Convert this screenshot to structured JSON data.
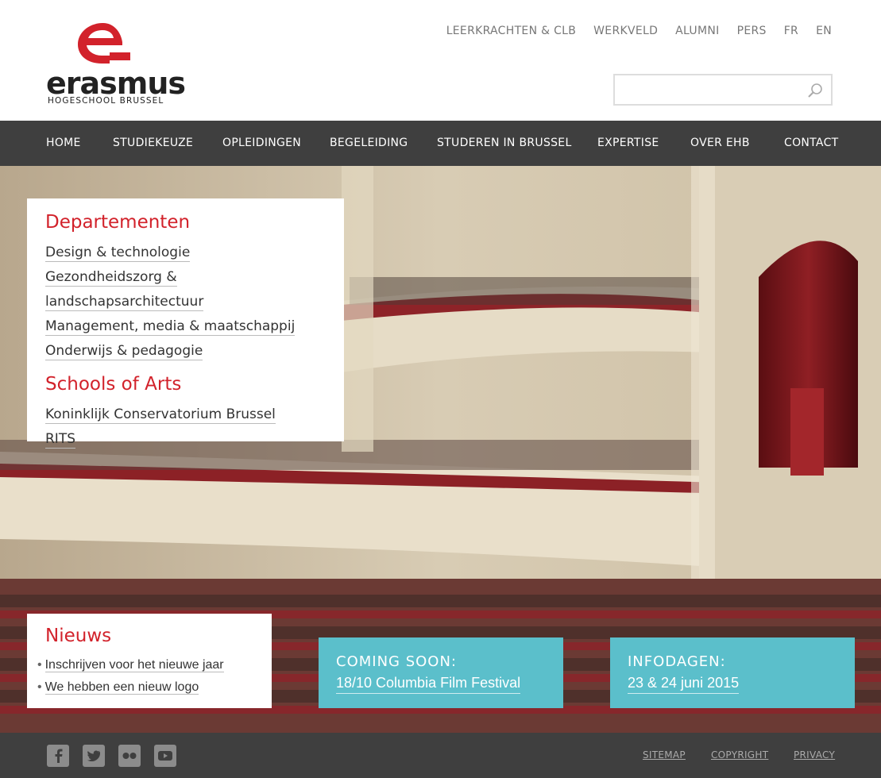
{
  "brand": {
    "name": "erasmus",
    "subtitle": "HOGESCHOOL  BRUSSEL",
    "accent_color": "#d2222b"
  },
  "topnav": {
    "items": [
      "LEERKRACHTEN & CLB",
      "WERKVELD",
      "ALUMNI",
      "PERS",
      "FR",
      "EN"
    ]
  },
  "search": {
    "value": "",
    "placeholder": "",
    "icon": "search-icon"
  },
  "mainnav": {
    "items": [
      "HOME",
      "STUDIEKEUZE",
      "OPLEIDINGEN",
      "BEGELEIDING",
      "STUDEREN IN BRUSSEL",
      "EXPERTISE",
      "OVER EHB",
      "CONTACT"
    ]
  },
  "departments": {
    "heading": "Departementen",
    "items": [
      "Design & technologie",
      "Gezondheidszorg & landschapsarchitectuur",
      "Management, media & maatschappij",
      "Onderwijs & pedagogie"
    ],
    "schools_heading": "Schools of Arts",
    "schools": [
      "Koninklijk Conservatorium Brussel",
      "RITS"
    ]
  },
  "news": {
    "heading": "Nieuws",
    "items": [
      "Inschrijven voor het nieuwe jaar",
      "We hebben een nieuw logo"
    ]
  },
  "promos": [
    {
      "title": "COMING SOON:",
      "text": "18/10 Columbia Film Festival"
    },
    {
      "title": "INFODAGEN:",
      "text": "23 & 24 juni 2015"
    }
  ],
  "promo_color": "#5bbfcb",
  "footer": {
    "social": [
      "facebook-icon",
      "twitter-icon",
      "flickr-icon",
      "youtube-icon"
    ],
    "links": [
      "SITEMAP",
      "COPYRIGHT",
      "PRIVACY"
    ]
  }
}
